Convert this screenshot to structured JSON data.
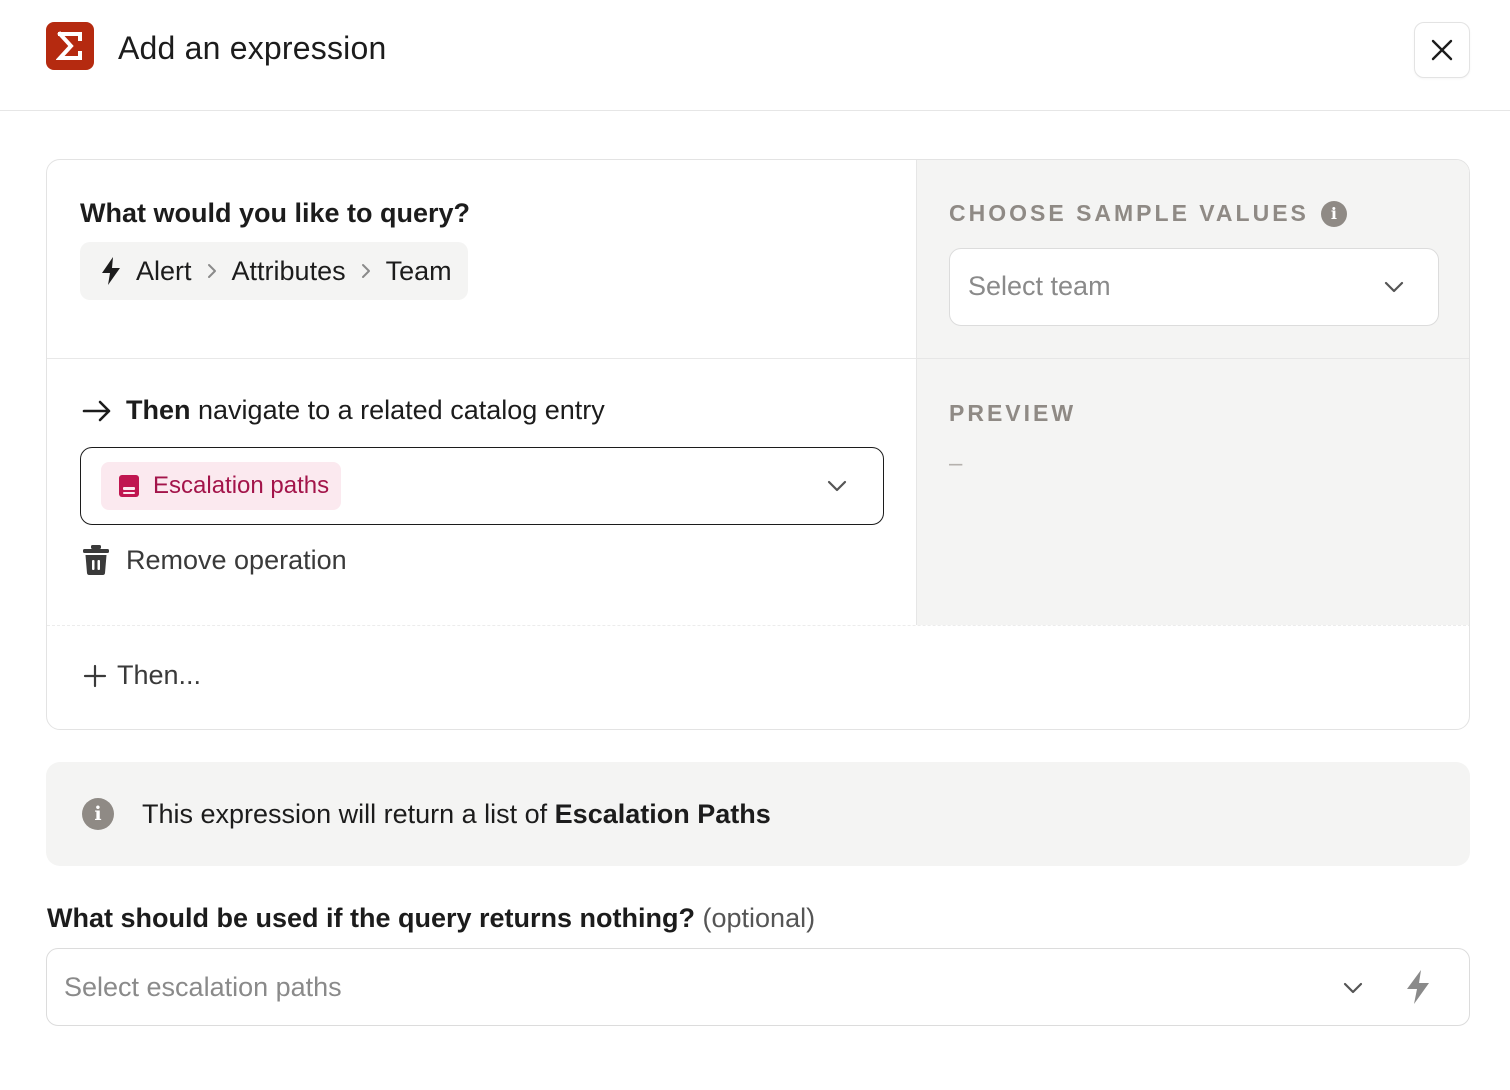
{
  "header": {
    "title": "Add an expression",
    "app_icon": "sigma-icon",
    "accent_color": "#b52a10"
  },
  "query": {
    "label": "What would you like to query?",
    "breadcrumb": [
      "Alert",
      "Attributes",
      "Team"
    ]
  },
  "operation": {
    "then_bold": "Then",
    "then_rest": "navigate to a related catalog entry",
    "selected_entry": "Escalation paths",
    "remove_label": "Remove operation"
  },
  "sample": {
    "label": "CHOOSE SAMPLE VALUES",
    "placeholder": "Select team"
  },
  "preview": {
    "label": "PREVIEW",
    "value": "–"
  },
  "add_then": {
    "label": "Then..."
  },
  "info": {
    "text_prefix": "This expression will return a list of",
    "text_bold": "Escalation Paths"
  },
  "fallback": {
    "label": "What should be used if the query returns nothing?",
    "optional": "(optional)",
    "placeholder": "Select escalation paths"
  }
}
